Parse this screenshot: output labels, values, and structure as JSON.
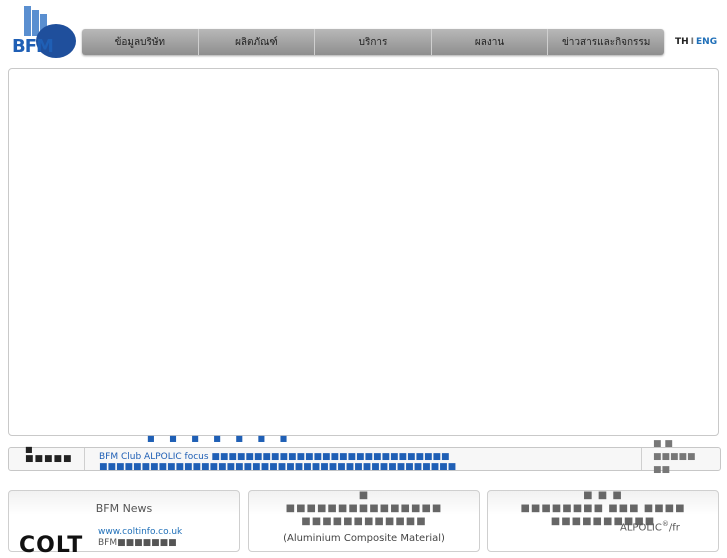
{
  "logo": {
    "text": "BFM"
  },
  "nav": {
    "items": [
      {
        "label": "ข้อมูลบริษัท"
      },
      {
        "label": "ผลิตภัณฑ์"
      },
      {
        "label": "บริการ"
      },
      {
        "label": "ผลงาน"
      },
      {
        "label": "ข่าวสารและกิจกรรม"
      }
    ]
  },
  "lang": {
    "th": "TH",
    "sep": "I",
    "eng": "ENG"
  },
  "ticker": {
    "label": "■■■■■",
    "label_pre": "■",
    "news": "BFM Club ALPOLIC focus ■■■■■■■■■■■■■■■■■■■■■■■■■■■■",
    "news_row2": "■■■■■■■■■■■■■■■■■■■■■■■■■■■■■■■■■■■■■■■■■■",
    "news_marks": "■ ■ ■ ■ ■ ■ ■",
    "more": "■ ■\n■■■■■\n■■"
  },
  "boxes": {
    "news": {
      "title": "BFM News",
      "logo": "COLT",
      "link": "www.coltinfo.co.uk",
      "link2": "BFM■■■■■■■"
    },
    "acm": {
      "title": "■\n■■■■■■■■■■■■■■■\n■■■■■■■■■■■■",
      "subtitle": "(Aluminium Composite Material)"
    },
    "alpolic": {
      "title": "■ ■ ■\n■■■■■■■■ ■■■ ■■■■\n■■■■■■■■■■",
      "brand": "ALPOLIC",
      "brand_sup": "®",
      "brand_suffix": "/fr"
    }
  }
}
